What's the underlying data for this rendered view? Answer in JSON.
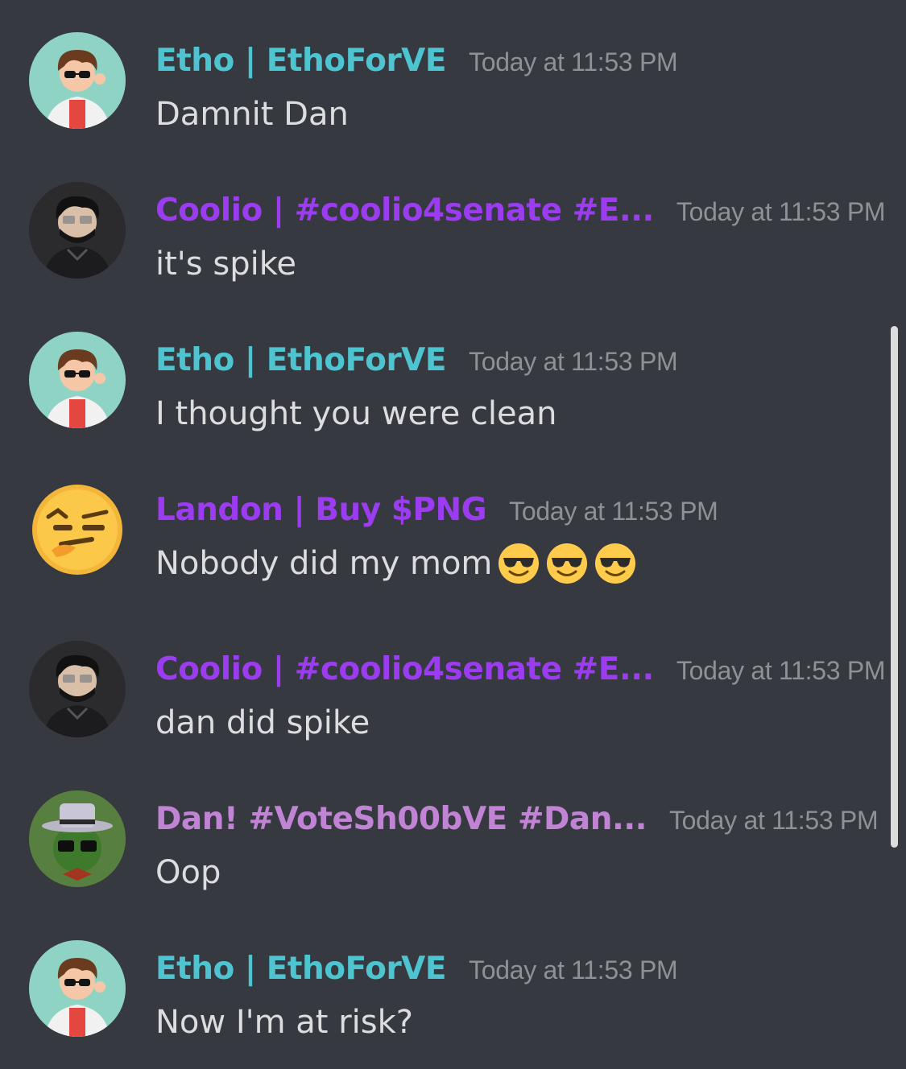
{
  "colors": {
    "background": "#36393f",
    "username_teal": "#4fc4d1",
    "username_purple": "#9b3cf0",
    "username_lavender": "#c183d4",
    "timestamp": "#8e9297",
    "message_text": "#dcddde"
  },
  "messages": [
    {
      "avatar": "etho-avatar",
      "username": "Etho | EthoForVE",
      "username_color": "#4fc4d1",
      "timestamp": "Today at 11:53 PM",
      "content": "Damnit Dan"
    },
    {
      "avatar": "coolio-avatar",
      "username": "Coolio | #coolio4senate #E...",
      "username_color": "#9b3cf0",
      "timestamp": "Today at 11:53 PM",
      "content": "it's spike"
    },
    {
      "avatar": "etho-avatar",
      "username": "Etho | EthoForVE",
      "username_color": "#4fc4d1",
      "timestamp": "Today at 11:53 PM",
      "content": "I thought you were clean"
    },
    {
      "avatar": "landon-avatar",
      "username": "Landon | Buy $PNG",
      "username_color": "#9b3cf0",
      "timestamp": "Today at 11:53 PM",
      "content": "Nobody did my mom",
      "emojis": [
        "sunglasses-emoji",
        "sunglasses-emoji",
        "sunglasses-emoji"
      ]
    },
    {
      "avatar": "coolio-avatar",
      "username": "Coolio | #coolio4senate #E...",
      "username_color": "#9b3cf0",
      "timestamp": "Today at 11:53 PM",
      "content": "dan did spike"
    },
    {
      "avatar": "dan-avatar",
      "username": "Dan! #VoteSh00bVE #Dan...",
      "username_color": "#c183d4",
      "timestamp": "Today at 11:53 PM",
      "content": "Oop"
    },
    {
      "avatar": "etho-avatar",
      "username": "Etho | EthoForVE",
      "username_color": "#4fc4d1",
      "timestamp": "Today at 11:53 PM",
      "content": "Now I'm at risk?"
    }
  ]
}
